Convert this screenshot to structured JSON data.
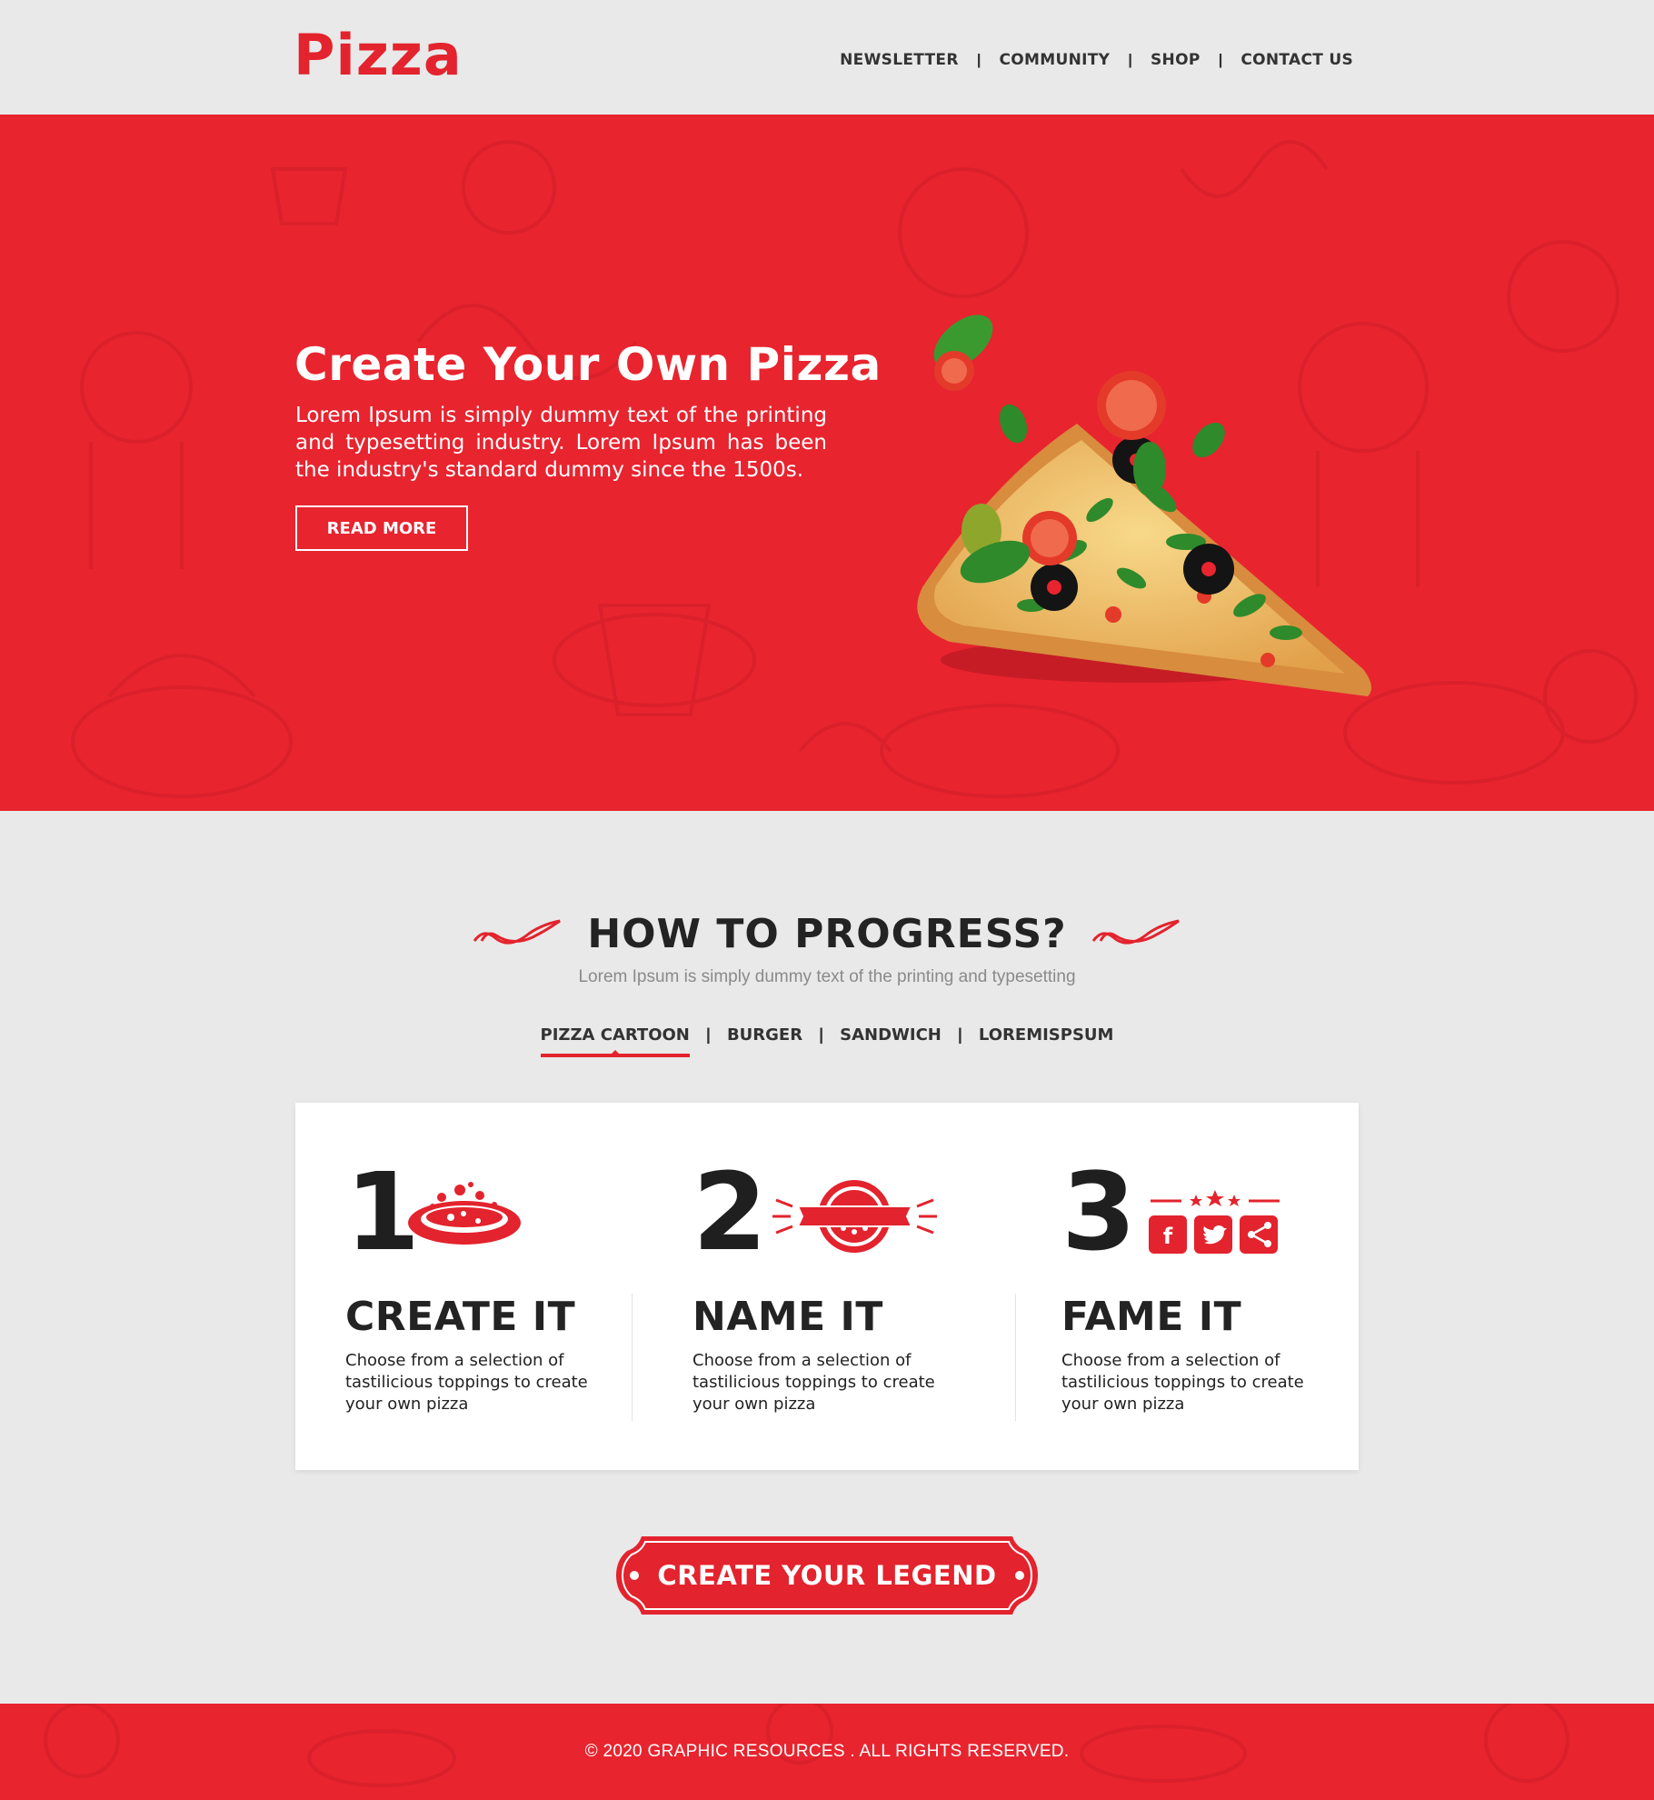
{
  "brand": {
    "logo_text": "Pizza",
    "accent_color": "#e3232d"
  },
  "nav": {
    "items": [
      "NEWSLETTER",
      "COMMUNITY",
      "SHOP",
      "CONTACT US"
    ],
    "separator": "|"
  },
  "hero": {
    "title": "Create Your Own Pizza",
    "text": "Lorem Ipsum is simply dummy text of the printing and typesetting industry. Lorem Ipsum has been the industry's standard dummy since the 1500s.",
    "button_label": "READ MORE"
  },
  "progress": {
    "title": "HOW TO PROGRESS?",
    "subtitle": "Lorem Ipsum is simply dummy text of the printing and typesetting",
    "tabs": [
      "PIZZA CARTOON",
      "BURGER",
      "SANDWICH",
      "LOREMISPSUM"
    ],
    "active_tab": "PIZZA CARTOON",
    "steps": [
      {
        "number": "1",
        "title": "CREATE IT",
        "text": "Choose from a selection of tastilicious toppings to create your own pizza",
        "icon": "pizza-icon"
      },
      {
        "number": "2",
        "title": "NAME IT",
        "text": "Choose from a selection of tastilicious toppings to create your own pizza",
        "icon": "pizza-badge-icon"
      },
      {
        "number": "3",
        "title": "FAME IT",
        "text": "Choose from a selection of tastilicious toppings to create your own pizza",
        "icon": "social-share-icon"
      }
    ]
  },
  "cta": {
    "label": "CREATE YOUR LEGEND"
  },
  "footer": {
    "text": "© 2020 GRAPHIC RESOURCES . ALL RIGHTS RESERVED."
  }
}
